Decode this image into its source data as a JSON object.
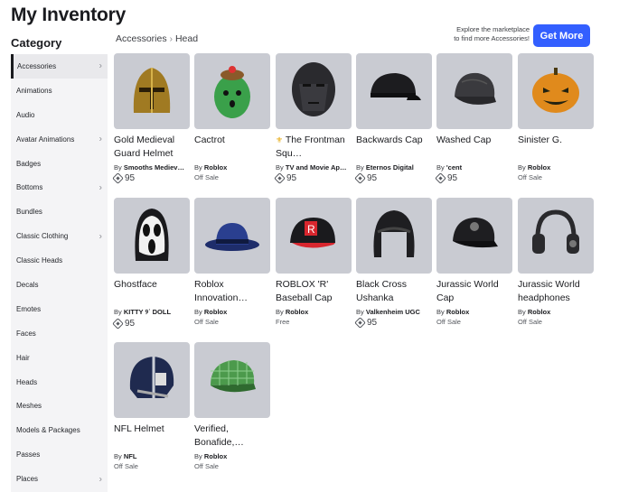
{
  "page": {
    "title": "My Inventory"
  },
  "sidebar": {
    "title": "Category",
    "items": [
      {
        "label": "Accessories",
        "chevron": true,
        "active": true
      },
      {
        "label": "Animations",
        "chevron": false
      },
      {
        "label": "Audio",
        "chevron": false
      },
      {
        "label": "Avatar Animations",
        "chevron": true
      },
      {
        "label": "Badges",
        "chevron": false
      },
      {
        "label": "Bottoms",
        "chevron": true
      },
      {
        "label": "Bundles",
        "chevron": false
      },
      {
        "label": "Classic Clothing",
        "chevron": true
      },
      {
        "label": "Classic Heads",
        "chevron": false
      },
      {
        "label": "Decals",
        "chevron": false
      },
      {
        "label": "Emotes",
        "chevron": false
      },
      {
        "label": "Faces",
        "chevron": false
      },
      {
        "label": "Hair",
        "chevron": false
      },
      {
        "label": "Heads",
        "chevron": false
      },
      {
        "label": "Meshes",
        "chevron": false
      },
      {
        "label": "Models & Packages",
        "chevron": false
      },
      {
        "label": "Passes",
        "chevron": false
      },
      {
        "label": "Places",
        "chevron": true
      }
    ]
  },
  "breadcrumb": {
    "items": [
      "Accessories",
      "Head"
    ],
    "separator": "›"
  },
  "promo": {
    "line1": "Explore the marketplace",
    "line2": "to find more Accessories!",
    "button": "Get More"
  },
  "items": [
    {
      "name": "Gold Medieval Guard Helmet",
      "by": "By",
      "creator": "Smooths Mediev…",
      "price": "95",
      "icon": "gold-helmet-icon",
      "color": "#a07a22"
    },
    {
      "name": "Cactrot",
      "by": "By",
      "creator": "Roblox",
      "status": "Off Sale",
      "icon": "cactrot-icon",
      "color": "#3aa04a"
    },
    {
      "name": "The Frontman Squ…",
      "star": "⚜",
      "by": "By",
      "creator": "TV and Movie Ap…",
      "price": "95",
      "icon": "frontman-mask-icon",
      "color": "#2a2a2e"
    },
    {
      "name": "Backwards Cap",
      "by": "By",
      "creator": "Eternos Digital",
      "price": "95",
      "icon": "backwards-cap-icon",
      "color": "#1c1c1f"
    },
    {
      "name": "Washed Cap",
      "by": "By",
      "creator": "'cent",
      "price": "95",
      "icon": "washed-cap-icon",
      "color": "#3a3a3e"
    },
    {
      "name": "Sinister G.",
      "by": "By",
      "creator": "Roblox",
      "status": "Off Sale",
      "icon": "pumpkin-icon",
      "color": "#e08a1c"
    },
    {
      "name": "Ghostface",
      "by": "By",
      "creator": "KITTY ୨ᐝ DOLL",
      "price": "95",
      "icon": "ghostface-mask-icon",
      "color": "#f2f2f2"
    },
    {
      "name": "Roblox Innovation…",
      "by": "By",
      "creator": "Roblox",
      "status": "Off Sale",
      "icon": "fedora-icon",
      "color": "#2a3f8f"
    },
    {
      "name": "ROBLOX 'R' Baseball Cap",
      "by": "By",
      "creator": "Roblox",
      "status": "Free",
      "icon": "r-cap-icon",
      "color": "#d8262e"
    },
    {
      "name": "Black Cross Ushanka",
      "by": "By",
      "creator": "Valkenheim UGC",
      "price": "95",
      "icon": "ushanka-icon",
      "color": "#1e1e21"
    },
    {
      "name": "Jurassic World Cap",
      "by": "By",
      "creator": "Roblox",
      "status": "Off Sale",
      "icon": "jurassic-cap-icon",
      "color": "#1e1e21"
    },
    {
      "name": "Jurassic World headphones",
      "by": "By",
      "creator": "Roblox",
      "status": "Off Sale",
      "icon": "headphones-icon",
      "color": "#2a2a2d"
    },
    {
      "name": "NFL Helmet",
      "by": "By",
      "creator": "NFL",
      "status": "Off Sale",
      "icon": "nfl-helmet-icon",
      "color": "#1f2a4f"
    },
    {
      "name": "Verified, Bonafide,…",
      "by": "By",
      "creator": "Roblox",
      "status": "Off Sale",
      "icon": "plaid-cap-icon",
      "color": "#4c9a4c"
    }
  ]
}
